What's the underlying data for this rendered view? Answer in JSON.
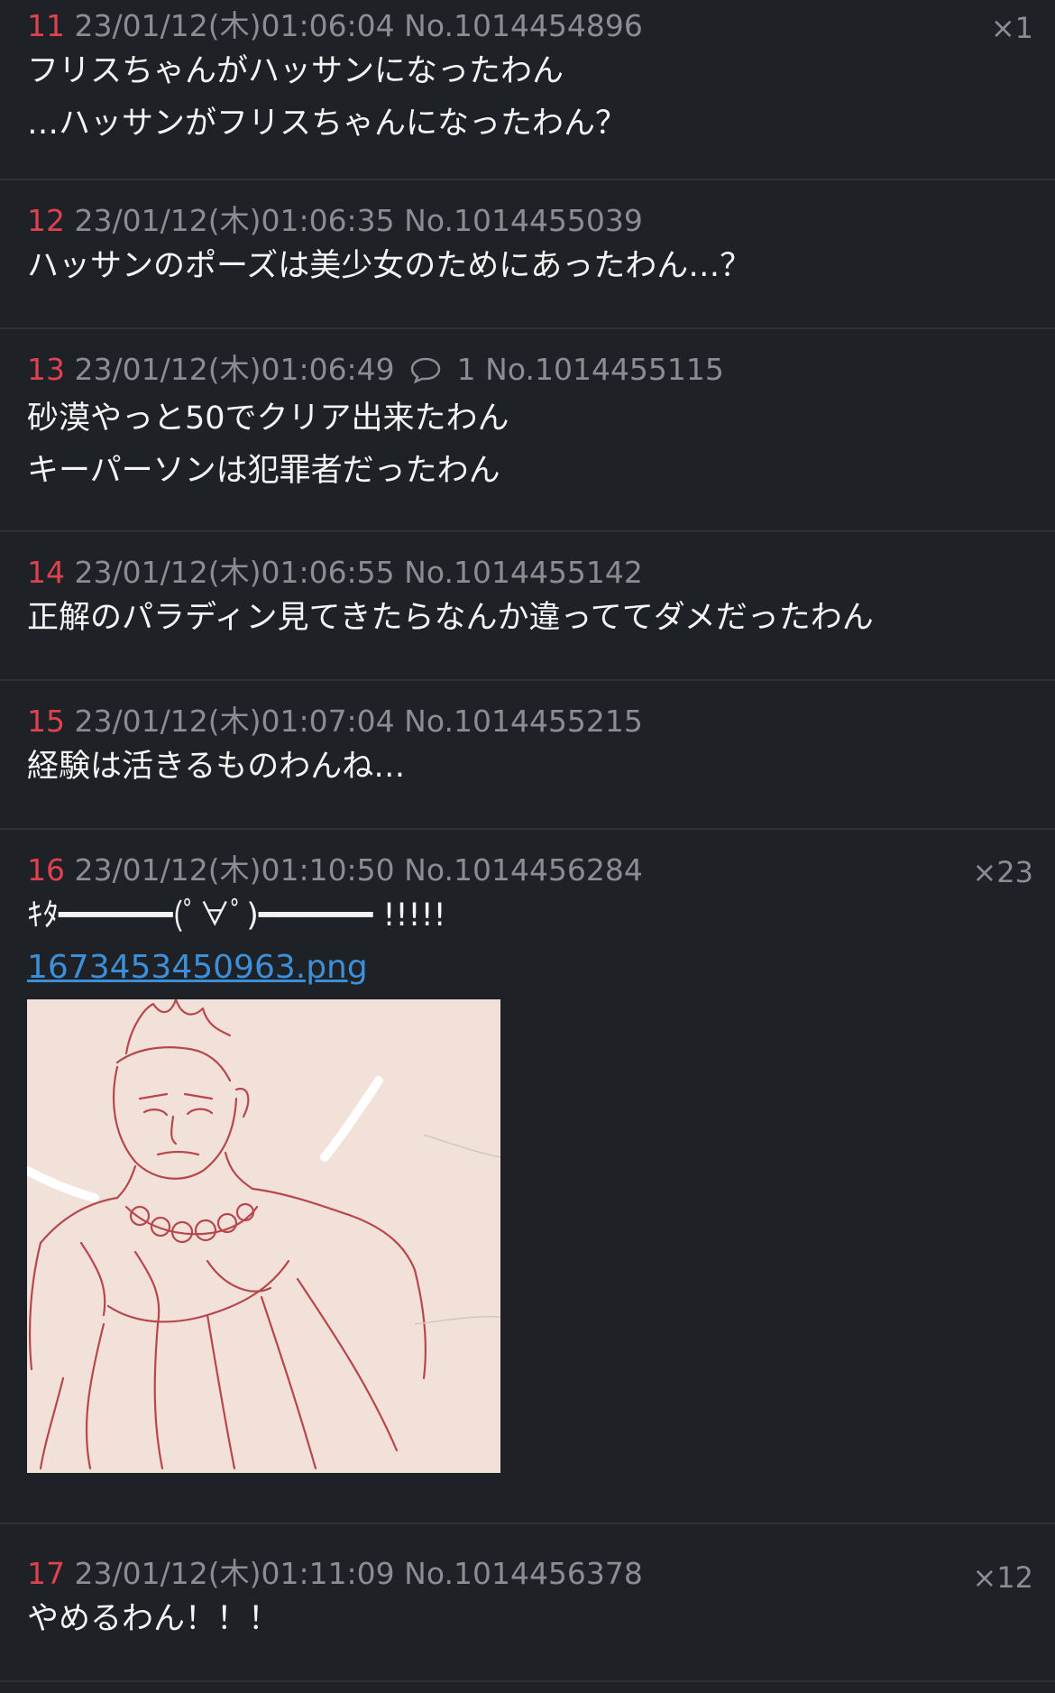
{
  "posts": [
    {
      "num": "11",
      "date": "23/01/12(木)01:06:04",
      "no": "No.1014454896",
      "count": "×1",
      "lines": [
        "フリスちゃんがハッサンになったわん",
        "…ハッサンがフリスちゃんになったわん？"
      ]
    },
    {
      "num": "12",
      "date": "23/01/12(木)01:06:35",
      "no": "No.1014455039",
      "count": "",
      "lines": [
        "ハッサンのポーズは美少女のためにあったわん…？"
      ]
    },
    {
      "num": "13",
      "date": "23/01/12(木)01:06:49",
      "replies": "1",
      "no": "No.1014455115",
      "count": "",
      "lines": [
        "砂漠やっと50でクリア出来たわん",
        "キーパーソンは犯罪者だったわん"
      ]
    },
    {
      "num": "14",
      "date": "23/01/12(木)01:06:55",
      "no": "No.1014455142",
      "count": "",
      "lines": [
        "正解のパラディン見てきたらなんか違っててダメだったわん"
      ]
    },
    {
      "num": "15",
      "date": "23/01/12(木)01:07:04",
      "no": "No.1014455215",
      "count": "",
      "lines": [
        "経験は活きるものわんね…"
      ]
    },
    {
      "num": "16",
      "date": "23/01/12(木)01:10:50",
      "no": "No.1014456284",
      "count": "×23",
      "lines": [
        "ｷﾀ━━━━━━(ﾟ∀ﾟ)━━━━━━ !!!!!"
      ],
      "file": "1673453450963.png"
    },
    {
      "num": "17",
      "date": "23/01/12(木)01:11:09",
      "no": "No.1014456378",
      "count": "×12",
      "lines": [
        "やめるわん！！！"
      ]
    }
  ],
  "colors": {
    "background": "#1e2125",
    "post_number": "#e0414f",
    "meta": "#8a8e94",
    "link": "#3d8fd8",
    "divider": "#2d3136"
  },
  "icons": {
    "reply_count": "speech-bubble-icon"
  }
}
